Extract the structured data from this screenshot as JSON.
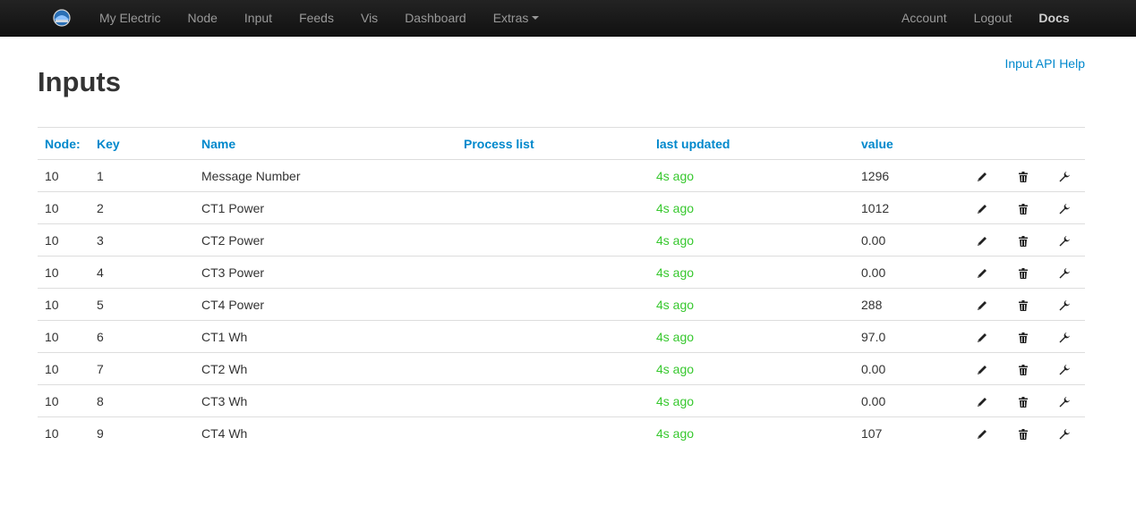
{
  "navbar": {
    "brand_icon": "emoncms-logo-icon",
    "left_items": [
      "My Electric",
      "Node",
      "Input",
      "Feeds",
      "Vis",
      "Dashboard",
      "Extras"
    ],
    "right_items": [
      "Account",
      "Logout",
      "Docs"
    ]
  },
  "page": {
    "title": "Inputs",
    "help_link": "Input API Help"
  },
  "table": {
    "headers": [
      "Node:",
      "Key",
      "Name",
      "Process list",
      "last updated",
      "value"
    ],
    "row_actions": [
      "pencil-icon",
      "trash-icon",
      "wrench-icon"
    ],
    "rows": [
      {
        "node": "10",
        "key": "1",
        "name": "Message Number",
        "process": "",
        "updated": "4s ago",
        "value": "1296"
      },
      {
        "node": "10",
        "key": "2",
        "name": "CT1 Power",
        "process": "",
        "updated": "4s ago",
        "value": "1012"
      },
      {
        "node": "10",
        "key": "3",
        "name": "CT2 Power",
        "process": "",
        "updated": "4s ago",
        "value": "0.00"
      },
      {
        "node": "10",
        "key": "4",
        "name": "CT3 Power",
        "process": "",
        "updated": "4s ago",
        "value": "0.00"
      },
      {
        "node": "10",
        "key": "5",
        "name": "CT4 Power",
        "process": "",
        "updated": "4s ago",
        "value": "288"
      },
      {
        "node": "10",
        "key": "6",
        "name": "CT1 Wh",
        "process": "",
        "updated": "4s ago",
        "value": "97.0"
      },
      {
        "node": "10",
        "key": "7",
        "name": "CT2 Wh",
        "process": "",
        "updated": "4s ago",
        "value": "0.00"
      },
      {
        "node": "10",
        "key": "8",
        "name": "CT3 Wh",
        "process": "",
        "updated": "4s ago",
        "value": "0.00"
      },
      {
        "node": "10",
        "key": "9",
        "name": "CT4 Wh",
        "process": "",
        "updated": "4s ago",
        "value": "107"
      }
    ]
  },
  "colors": {
    "link": "#0088cc",
    "updated_recent": "#37c82e",
    "navbar_bg": "#1b1b1b"
  }
}
